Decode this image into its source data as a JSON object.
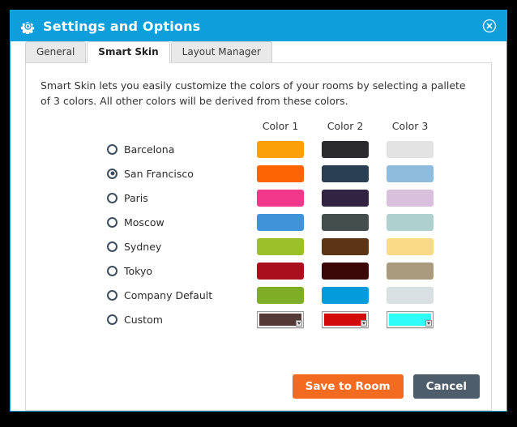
{
  "window": {
    "title": "Settings and Options",
    "gear_icon": "gear-icon",
    "close_icon": "close-circle-icon",
    "titlebar_color": "#0d9fdb"
  },
  "tabs": [
    {
      "label": "General",
      "active": false
    },
    {
      "label": "Smart Skin",
      "active": true
    },
    {
      "label": "Layout Manager",
      "active": false
    }
  ],
  "content": {
    "description": "Smart Skin lets you easily customize the colors of your rooms by selecting a pallete of 3 colors. All other colors will be derived from these colors.",
    "column_headers": [
      "Color 1",
      "Color 2",
      "Color 3"
    ],
    "rows": [
      {
        "label": "Barcelona",
        "selected": false,
        "type": "swatch",
        "colors": [
          "#fca00a",
          "#2b2b2d",
          "#e3e3e4"
        ]
      },
      {
        "label": "San Francisco",
        "selected": true,
        "type": "swatch",
        "colors": [
          "#fd6404",
          "#2b3f54",
          "#8fbcdc"
        ]
      },
      {
        "label": "Paris",
        "selected": false,
        "type": "swatch",
        "colors": [
          "#f2388b",
          "#322343",
          "#d9c0dd"
        ]
      },
      {
        "label": "Moscow",
        "selected": false,
        "type": "swatch",
        "colors": [
          "#3e93d9",
          "#444f4d",
          "#aed0ce"
        ]
      },
      {
        "label": "Sydney",
        "selected": false,
        "type": "swatch",
        "colors": [
          "#9cc02a",
          "#5e3416",
          "#fbda86"
        ]
      },
      {
        "label": "Tokyo",
        "selected": false,
        "type": "swatch",
        "colors": [
          "#a90f1c",
          "#3c0807",
          "#a99b7b"
        ]
      },
      {
        "label": "Company Default",
        "selected": false,
        "type": "swatch",
        "colors": [
          "#7fad26",
          "#049bda",
          "#d9e0e1"
        ]
      },
      {
        "label": "Custom",
        "selected": false,
        "type": "picker",
        "colors": [
          "#553936",
          "#d20a09",
          "#2ffdf9"
        ]
      }
    ]
  },
  "footer": {
    "save_label": "Save to Room",
    "cancel_label": "Cancel",
    "save_color": "#f36b21",
    "cancel_color": "#4e5d6c"
  }
}
